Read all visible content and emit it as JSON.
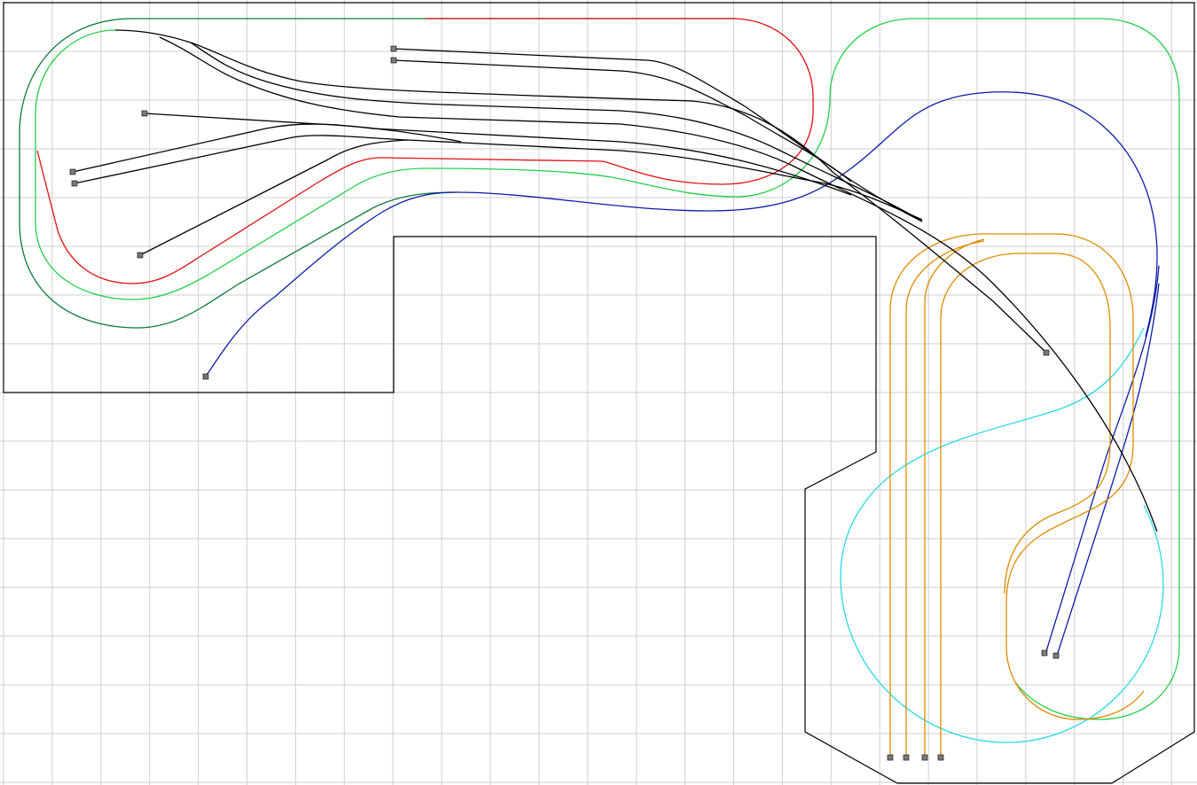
{
  "colors": {
    "background": "#ffffff",
    "grid": "#cfcfcf",
    "baseboard": "#000000",
    "yard": "#000000",
    "outer_loop": "#0a7a3a",
    "red_loop": "#e01010",
    "green_loop": "#22d04a",
    "blue_line": "#0b1ea8",
    "cyan_loop": "#28d8e8",
    "orange_loop": "#e08a00",
    "buffer_fill": "#7a7a7a"
  },
  "icons": {
    "buffer_stop": "buffer-stop-icon"
  },
  "view": {
    "grid_visible": true
  }
}
